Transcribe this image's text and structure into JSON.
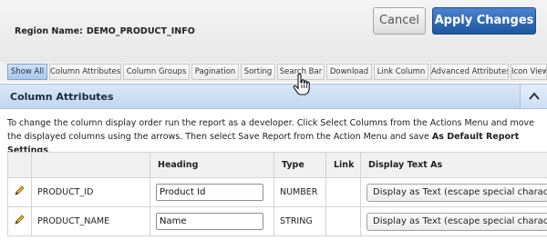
{
  "header": {
    "region_label": "Region Name:",
    "region_value": "DEMO_PRODUCT_INFO",
    "cancel_label": "Cancel",
    "apply_label": "Apply Changes"
  },
  "tabs": [
    {
      "label": "Show All",
      "active": true
    },
    {
      "label": "Column Attributes"
    },
    {
      "label": "Column Groups"
    },
    {
      "label": "Pagination"
    },
    {
      "label": "Sorting"
    },
    {
      "label": "Search Bar"
    },
    {
      "label": "Download"
    },
    {
      "label": "Link Column"
    },
    {
      "label": "Advanced Attributes"
    },
    {
      "label": "Icon View"
    }
  ],
  "section": {
    "title": "Column Attributes",
    "description_plain": "To change the column display order run the report as a developer. Click Select Columns from the Actions Menu and move the displayed columns using the arrows. Then select Save Report from the Action Menu and save",
    "description_bold": "As Default Report Settings",
    "description_end": "."
  },
  "table": {
    "headers": [
      "",
      "",
      "Heading",
      "Type",
      "Link",
      "Display Text As"
    ],
    "rows": [
      {
        "column": "PRODUCT_ID",
        "heading": "Product Id",
        "type": "NUMBER",
        "link": "",
        "display": "Display as Text (escape special characters)"
      },
      {
        "column": "PRODUCT_NAME",
        "heading": "Name",
        "type": "STRING",
        "link": "",
        "display": "Display as Text (escape special characters)"
      }
    ]
  },
  "icons": {
    "collapse": "chevron-up-icon",
    "edit": "pencil-icon",
    "cursor": "hand-pointer-icon"
  },
  "colors": {
    "accent": "#1d569e",
    "section_bg": "#c9dcf1",
    "active_tab": "#b9d3f1"
  }
}
